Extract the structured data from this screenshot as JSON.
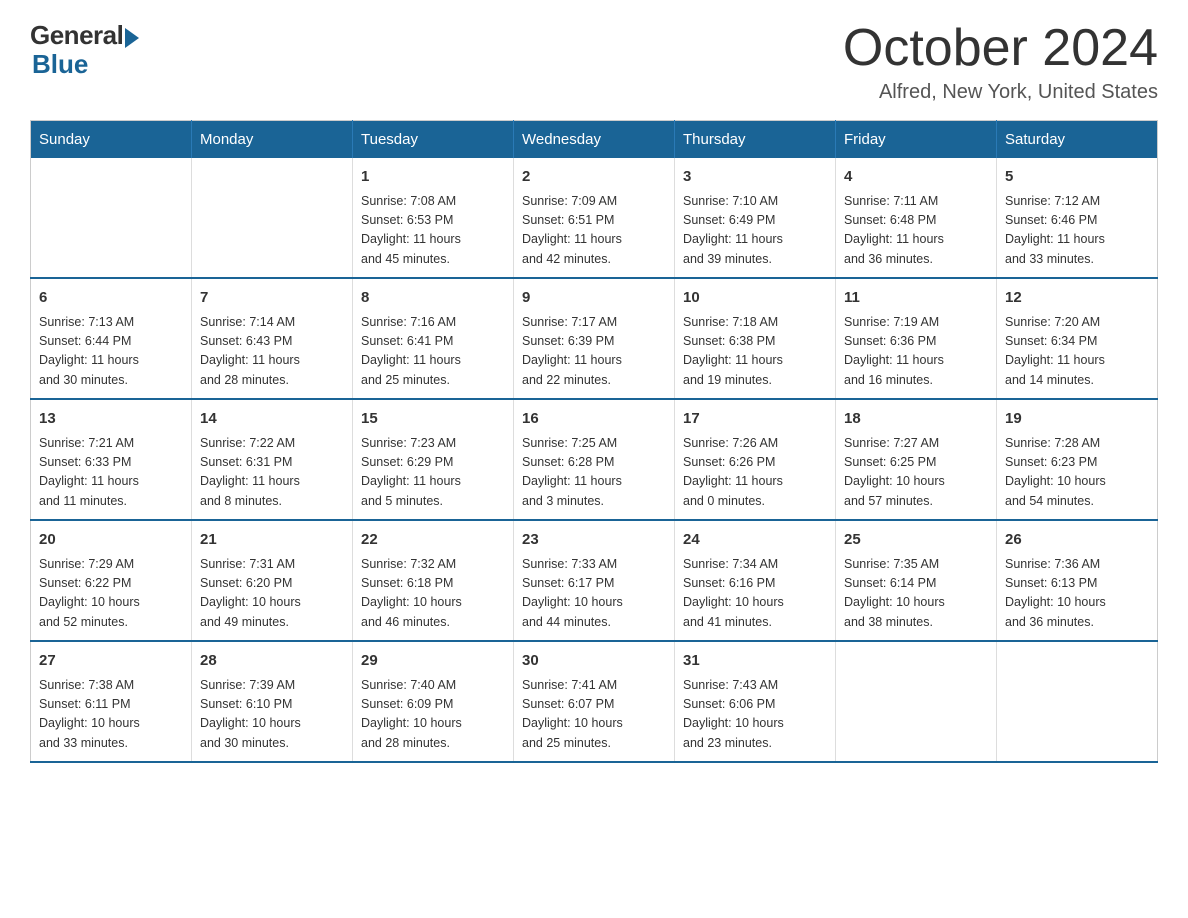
{
  "logo": {
    "general": "General",
    "blue": "Blue"
  },
  "header": {
    "month_title": "October 2024",
    "location": "Alfred, New York, United States"
  },
  "weekdays": [
    "Sunday",
    "Monday",
    "Tuesday",
    "Wednesday",
    "Thursday",
    "Friday",
    "Saturday"
  ],
  "weeks": [
    [
      {
        "day": "",
        "info": ""
      },
      {
        "day": "",
        "info": ""
      },
      {
        "day": "1",
        "info": "Sunrise: 7:08 AM\nSunset: 6:53 PM\nDaylight: 11 hours\nand 45 minutes."
      },
      {
        "day": "2",
        "info": "Sunrise: 7:09 AM\nSunset: 6:51 PM\nDaylight: 11 hours\nand 42 minutes."
      },
      {
        "day": "3",
        "info": "Sunrise: 7:10 AM\nSunset: 6:49 PM\nDaylight: 11 hours\nand 39 minutes."
      },
      {
        "day": "4",
        "info": "Sunrise: 7:11 AM\nSunset: 6:48 PM\nDaylight: 11 hours\nand 36 minutes."
      },
      {
        "day": "5",
        "info": "Sunrise: 7:12 AM\nSunset: 6:46 PM\nDaylight: 11 hours\nand 33 minutes."
      }
    ],
    [
      {
        "day": "6",
        "info": "Sunrise: 7:13 AM\nSunset: 6:44 PM\nDaylight: 11 hours\nand 30 minutes."
      },
      {
        "day": "7",
        "info": "Sunrise: 7:14 AM\nSunset: 6:43 PM\nDaylight: 11 hours\nand 28 minutes."
      },
      {
        "day": "8",
        "info": "Sunrise: 7:16 AM\nSunset: 6:41 PM\nDaylight: 11 hours\nand 25 minutes."
      },
      {
        "day": "9",
        "info": "Sunrise: 7:17 AM\nSunset: 6:39 PM\nDaylight: 11 hours\nand 22 minutes."
      },
      {
        "day": "10",
        "info": "Sunrise: 7:18 AM\nSunset: 6:38 PM\nDaylight: 11 hours\nand 19 minutes."
      },
      {
        "day": "11",
        "info": "Sunrise: 7:19 AM\nSunset: 6:36 PM\nDaylight: 11 hours\nand 16 minutes."
      },
      {
        "day": "12",
        "info": "Sunrise: 7:20 AM\nSunset: 6:34 PM\nDaylight: 11 hours\nand 14 minutes."
      }
    ],
    [
      {
        "day": "13",
        "info": "Sunrise: 7:21 AM\nSunset: 6:33 PM\nDaylight: 11 hours\nand 11 minutes."
      },
      {
        "day": "14",
        "info": "Sunrise: 7:22 AM\nSunset: 6:31 PM\nDaylight: 11 hours\nand 8 minutes."
      },
      {
        "day": "15",
        "info": "Sunrise: 7:23 AM\nSunset: 6:29 PM\nDaylight: 11 hours\nand 5 minutes."
      },
      {
        "day": "16",
        "info": "Sunrise: 7:25 AM\nSunset: 6:28 PM\nDaylight: 11 hours\nand 3 minutes."
      },
      {
        "day": "17",
        "info": "Sunrise: 7:26 AM\nSunset: 6:26 PM\nDaylight: 11 hours\nand 0 minutes."
      },
      {
        "day": "18",
        "info": "Sunrise: 7:27 AM\nSunset: 6:25 PM\nDaylight: 10 hours\nand 57 minutes."
      },
      {
        "day": "19",
        "info": "Sunrise: 7:28 AM\nSunset: 6:23 PM\nDaylight: 10 hours\nand 54 minutes."
      }
    ],
    [
      {
        "day": "20",
        "info": "Sunrise: 7:29 AM\nSunset: 6:22 PM\nDaylight: 10 hours\nand 52 minutes."
      },
      {
        "day": "21",
        "info": "Sunrise: 7:31 AM\nSunset: 6:20 PM\nDaylight: 10 hours\nand 49 minutes."
      },
      {
        "day": "22",
        "info": "Sunrise: 7:32 AM\nSunset: 6:18 PM\nDaylight: 10 hours\nand 46 minutes."
      },
      {
        "day": "23",
        "info": "Sunrise: 7:33 AM\nSunset: 6:17 PM\nDaylight: 10 hours\nand 44 minutes."
      },
      {
        "day": "24",
        "info": "Sunrise: 7:34 AM\nSunset: 6:16 PM\nDaylight: 10 hours\nand 41 minutes."
      },
      {
        "day": "25",
        "info": "Sunrise: 7:35 AM\nSunset: 6:14 PM\nDaylight: 10 hours\nand 38 minutes."
      },
      {
        "day": "26",
        "info": "Sunrise: 7:36 AM\nSunset: 6:13 PM\nDaylight: 10 hours\nand 36 minutes."
      }
    ],
    [
      {
        "day": "27",
        "info": "Sunrise: 7:38 AM\nSunset: 6:11 PM\nDaylight: 10 hours\nand 33 minutes."
      },
      {
        "day": "28",
        "info": "Sunrise: 7:39 AM\nSunset: 6:10 PM\nDaylight: 10 hours\nand 30 minutes."
      },
      {
        "day": "29",
        "info": "Sunrise: 7:40 AM\nSunset: 6:09 PM\nDaylight: 10 hours\nand 28 minutes."
      },
      {
        "day": "30",
        "info": "Sunrise: 7:41 AM\nSunset: 6:07 PM\nDaylight: 10 hours\nand 25 minutes."
      },
      {
        "day": "31",
        "info": "Sunrise: 7:43 AM\nSunset: 6:06 PM\nDaylight: 10 hours\nand 23 minutes."
      },
      {
        "day": "",
        "info": ""
      },
      {
        "day": "",
        "info": ""
      }
    ]
  ]
}
